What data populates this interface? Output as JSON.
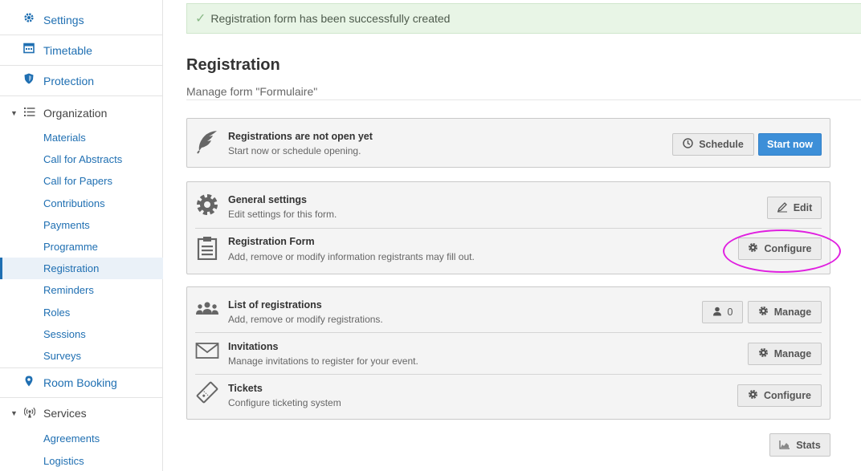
{
  "sidebar": {
    "top_items": [
      {
        "label": "Settings",
        "icon": "gear-icon"
      },
      {
        "label": "Timetable",
        "icon": "calendar-icon"
      },
      {
        "label": "Protection",
        "icon": "shield-icon"
      }
    ],
    "organization": {
      "label": "Organization",
      "icon": "list-icon",
      "items": [
        "Materials",
        "Call for Abstracts",
        "Call for Papers",
        "Contributions",
        "Payments",
        "Programme",
        "Registration",
        "Reminders",
        "Roles",
        "Sessions",
        "Surveys"
      ],
      "active": "Registration"
    },
    "room_booking": {
      "label": "Room Booking",
      "icon": "map-marker-icon"
    },
    "services": {
      "label": "Services",
      "icon": "broadcast-icon",
      "items": [
        "Agreements",
        "Logistics"
      ]
    }
  },
  "alert": {
    "message": "Registration form has been successfully created"
  },
  "header": {
    "title": "Registration",
    "subtitle": "Manage form \"Formulaire\""
  },
  "open_card": {
    "title": "Registrations are not open yet",
    "desc": "Start now or schedule opening.",
    "schedule_label": "Schedule",
    "start_label": "Start now"
  },
  "settings_card": {
    "general": {
      "title": "General settings",
      "desc": "Edit settings for this form.",
      "button": "Edit"
    },
    "form": {
      "title": "Registration Form",
      "desc": "Add, remove or modify information registrants may fill out.",
      "button": "Configure"
    }
  },
  "lists_card": {
    "registrations": {
      "title": "List of registrations",
      "desc": "Add, remove or modify registrations.",
      "count": "0",
      "button": "Manage"
    },
    "invitations": {
      "title": "Invitations",
      "desc": "Manage invitations to register for your event.",
      "button": "Manage"
    },
    "tickets": {
      "title": "Tickets",
      "desc": "Configure ticketing system",
      "button": "Configure"
    }
  },
  "stats_label": "Stats",
  "colors": {
    "link": "#1f6fb2",
    "primary": "#3d8fd8",
    "success_bg": "#e8f5e6",
    "annotation": "#e020e0"
  }
}
